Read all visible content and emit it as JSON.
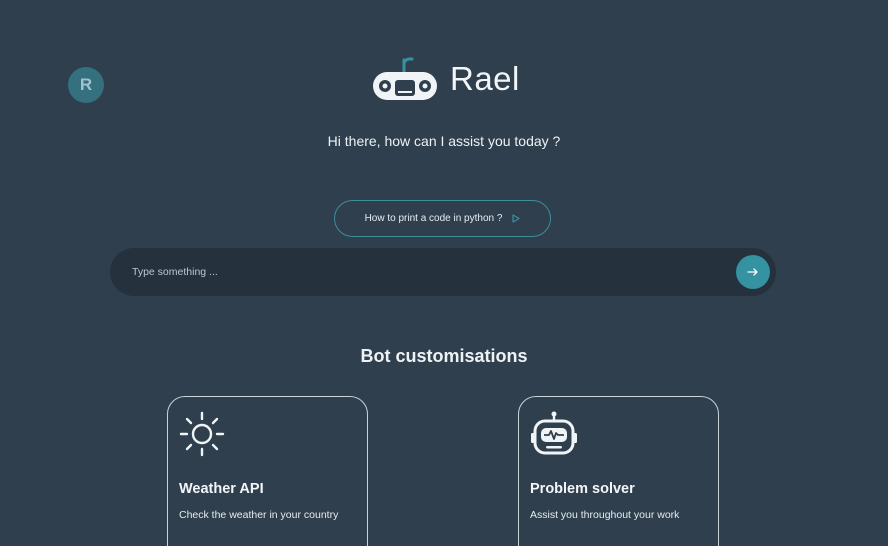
{
  "user": {
    "avatar_initial": "R"
  },
  "brand": {
    "name": "Rael",
    "logo_icon": "robot-face-icon"
  },
  "greeting": "Hi there, how can I assist you today ?",
  "suggestion": {
    "label": "How to print a code in python ?",
    "icon": "play-icon"
  },
  "chat": {
    "placeholder": "Type something ...",
    "value": "",
    "send_icon": "arrow-right-icon"
  },
  "customisations": {
    "title": "Bot customisations",
    "cards": [
      {
        "title": "Weather API",
        "description": "Check the weather in your country",
        "icon": "sun-icon"
      },
      {
        "title": "Problem solver",
        "description": "Assist you throughout your work",
        "icon": "robot-icon"
      }
    ]
  },
  "colors": {
    "background": "#2f3f4e",
    "chatbar": "#25313c",
    "accent": "#3592a0",
    "avatar": "#34707e"
  }
}
